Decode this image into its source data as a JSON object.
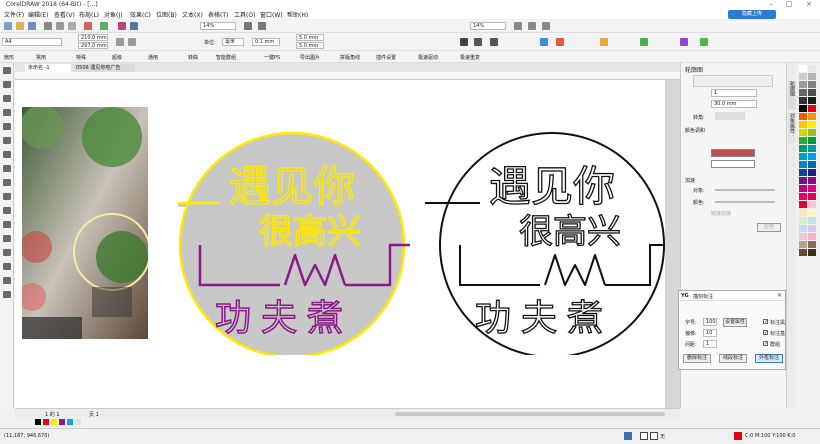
{
  "window": {
    "title": "CorelDRAW 2018 (64-Bit) - [...]"
  },
  "menubar": {
    "items": [
      "文件(F)",
      "编辑(E)",
      "查看(V)",
      "布局(L)",
      "对象(J)",
      "效果(C)",
      "位图(B)",
      "文本(X)",
      "表格(T)",
      "工具(O)",
      "窗口(W)",
      "帮助(H)"
    ]
  },
  "cloud_button": "隐藏上传",
  "toolbar1": {
    "zoom": "14%",
    "zoom2": "14%"
  },
  "propbar": {
    "page_size": "A4",
    "width": "210.0 mm",
    "height": "297.0 mm",
    "units_label": "单位:",
    "units": "毫米",
    "nudge": "0.1 mm",
    "dup1": "5.0 mm",
    "dup2": "5.0 mm"
  },
  "pluginbar": {
    "items": [
      "扇形",
      "常用",
      "特殊",
      "超级",
      "通用",
      "转曲",
      "智能群组",
      "一键PS",
      "导出图片",
      "拼版角线",
      "插件设置",
      "极速驱动",
      "极速重复"
    ]
  },
  "doc_tabs": [
    "未命名 -1",
    "0506 遇见你吧广告"
  ],
  "artwork": {
    "line1": "遇见你",
    "line2": "很高兴",
    "line3": "功夫煮"
  },
  "panel": {
    "title": "轮廓图",
    "steps": "1",
    "offset": "30.0 mm",
    "corners_label": "转角:",
    "color_label": "颜色调和",
    "accel_label": "加速",
    "object_label": "对象:",
    "color2_label": "颜色:",
    "link_label": "链接加速",
    "apply": "应用",
    "side_tab1": "轮廓图",
    "side_tab2": "对象属性"
  },
  "dialog": {
    "title": "描刻标注",
    "size_label": "字号:",
    "size_value": "100",
    "set_prop": "设置属性",
    "offset_label": "偏移:",
    "offset_value": "10",
    "gap_label": "间距:",
    "gap_value": "1",
    "cb1": "标注黑",
    "cb2": "标注基",
    "cb3": "群组",
    "btn_del": "删除标注",
    "btn_line": "线段标注",
    "btn_mark": "外框标注"
  },
  "status": {
    "coords": "(11,187; 946,670)",
    "page_nav": "1 的 1",
    "page_tab": "页 1",
    "fill_label": "无",
    "color_info": "C:0 M:100 Y:100 K:0"
  },
  "colors": {
    "yellow": "#ffea00",
    "purple": "#8b1a88",
    "gray": "#c8c8c8",
    "red": "#e60012"
  }
}
